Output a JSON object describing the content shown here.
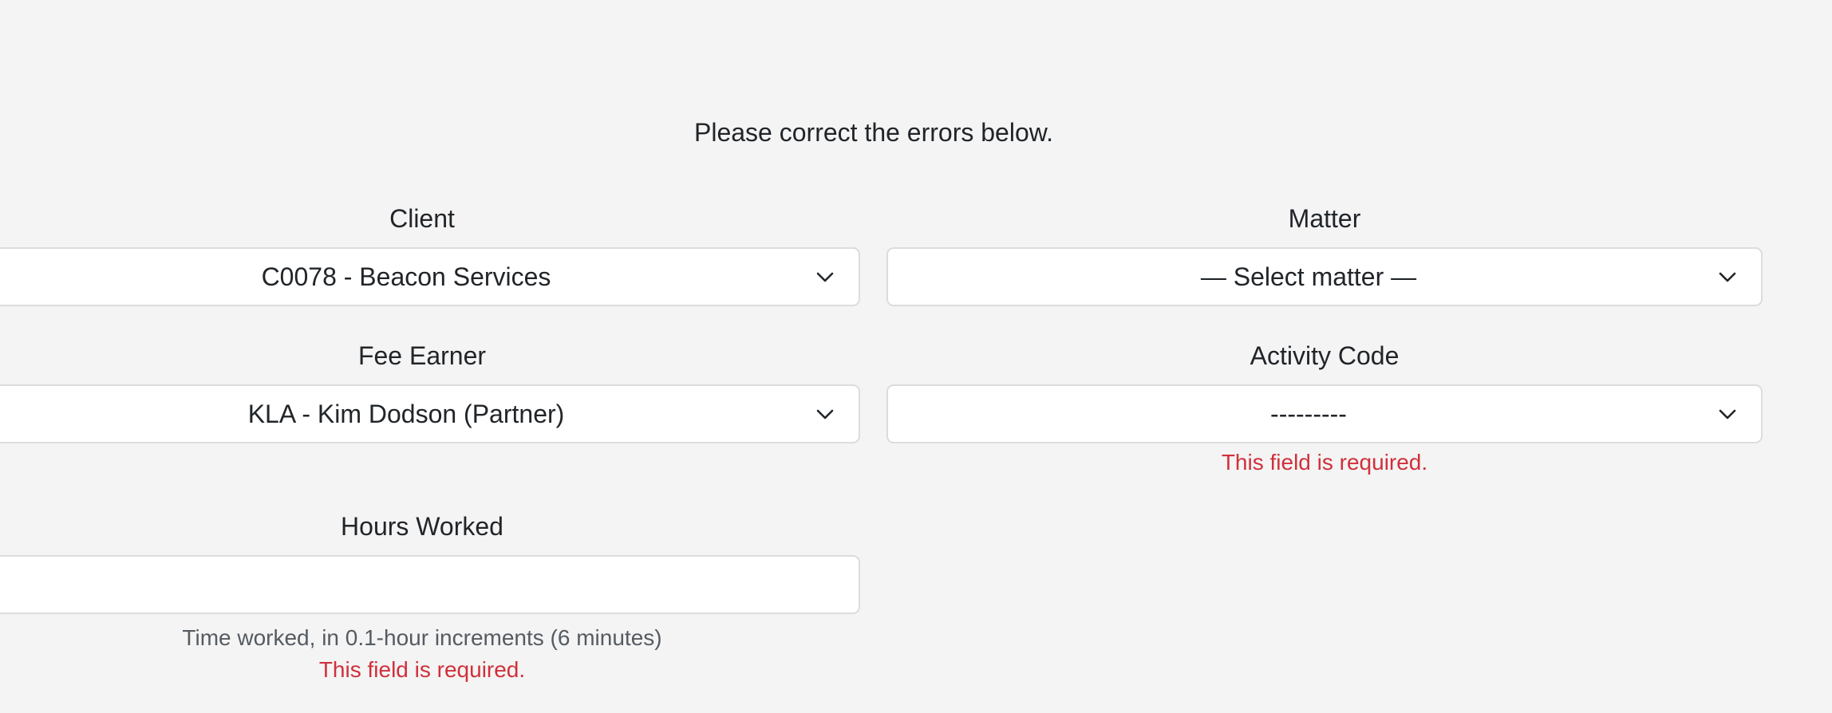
{
  "form": {
    "error_summary": "Please correct the errors below.",
    "client": {
      "label": "Client",
      "selected": "C0078 - Beacon Services"
    },
    "matter": {
      "label": "Matter",
      "selected": "— Select matter —"
    },
    "fee_earner": {
      "label": "Fee Earner",
      "selected": "KLA - Kim Dodson (Partner)"
    },
    "activity_code": {
      "label": "Activity Code",
      "selected": "---------",
      "error": "This field is required."
    },
    "hours_worked": {
      "label": "Hours Worked",
      "value": "",
      "help": "Time worked, in 0.1-hour increments (6 minutes)",
      "error": "This field is required."
    }
  },
  "icons": {
    "dropdown": "chevron-down-icon"
  },
  "colors": {
    "background": "#f4f4f4",
    "error": "#d0303b",
    "border": "#dcdcdc"
  }
}
